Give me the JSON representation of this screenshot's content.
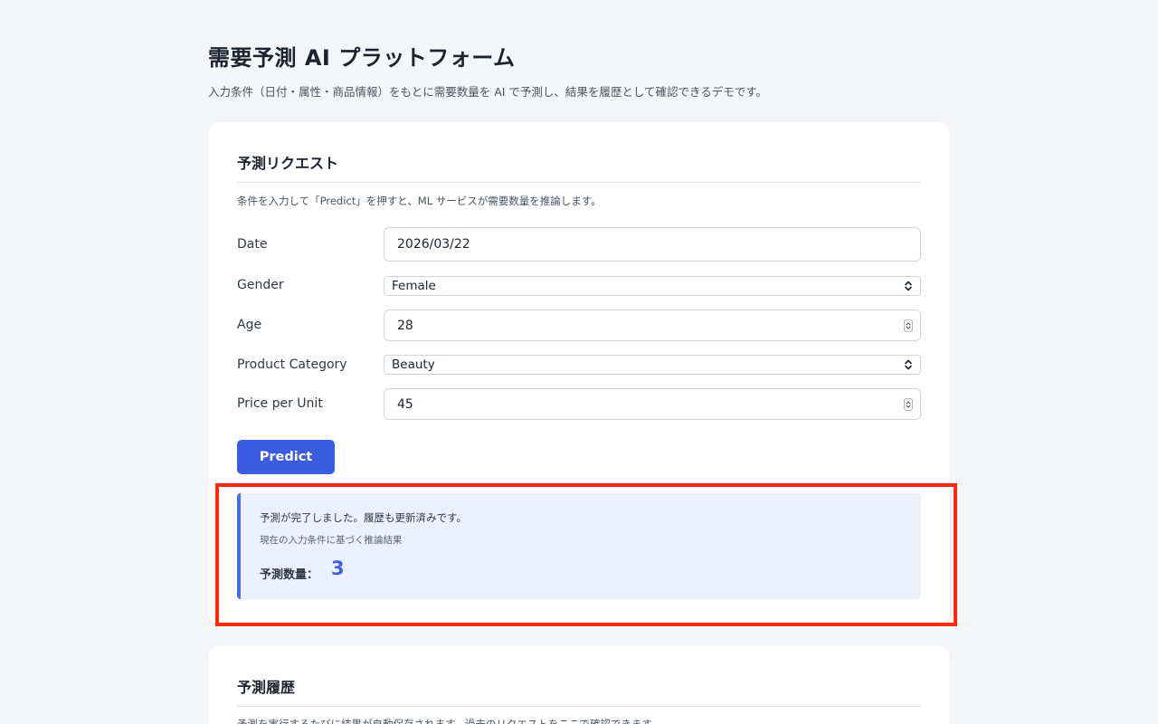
{
  "header": {
    "title": "需要予測 AI プラットフォーム",
    "subtitle": "入力条件（日付・属性・商品情報）をもとに需要数量を AI で予測し、結果を履歴として確認できるデモです。"
  },
  "request": {
    "title": "予測リクエスト",
    "description": "条件を入力して「Predict」を押すと、ML サービスが需要数量を推論します。",
    "fields": {
      "date": {
        "label": "Date",
        "value": "2026/03/22"
      },
      "gender": {
        "label": "Gender",
        "value": "Female"
      },
      "age": {
        "label": "Age",
        "value": "28"
      },
      "category": {
        "label": "Product Category",
        "value": "Beauty"
      },
      "price": {
        "label": "Price per Unit",
        "value": "45"
      }
    },
    "predict_label": "Predict"
  },
  "result": {
    "message": "予測が完了しました。履歴も更新済みです。",
    "sub": "現在の入力条件に基づく推論結果",
    "quantity_label": "予測数量：",
    "quantity_value": "3"
  },
  "history": {
    "title": "予測履歴",
    "description": "予測を実行するたびに結果が自動保存されます。過去のリクエストをここで確認できます。"
  },
  "colors": {
    "accent": "#3b5ce0",
    "highlight": "#ff2a0d",
    "result_bg": "#ecf1fd"
  }
}
